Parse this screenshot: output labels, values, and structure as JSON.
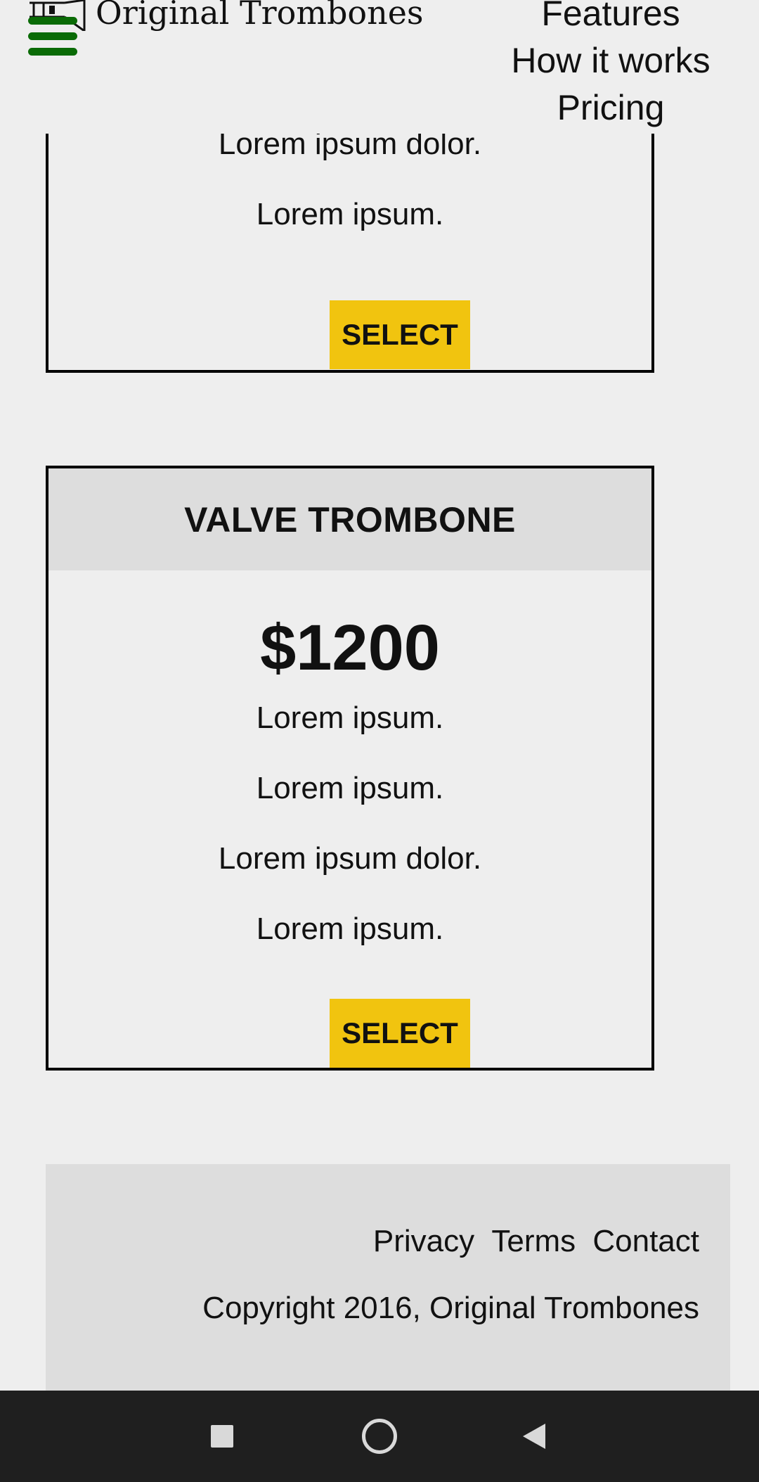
{
  "header": {
    "logo_text": "Original Trombones",
    "nav": [
      "Features",
      "How it works",
      "Pricing"
    ]
  },
  "cards": [
    {
      "features": [
        "Lorem ipsum dolor.",
        "Lorem ipsum."
      ],
      "button_label": "SELECT"
    },
    {
      "title": "VALVE TROMBONE",
      "price": "$1200",
      "features": [
        "Lorem ipsum.",
        "Lorem ipsum.",
        "Lorem ipsum dolor.",
        "Lorem ipsum."
      ],
      "button_label": "SELECT"
    }
  ],
  "footer": {
    "links": [
      "Privacy",
      "Terms",
      "Contact"
    ],
    "copyright": "Copyright 2016, Original Trombones"
  },
  "colors": {
    "accent_button": "#f1c40f",
    "hamburger": "#0a6b06",
    "system_bar": "#1f1f1f"
  },
  "system_nav": {
    "icons": [
      "recent-apps-icon",
      "home-icon",
      "back-icon"
    ]
  }
}
